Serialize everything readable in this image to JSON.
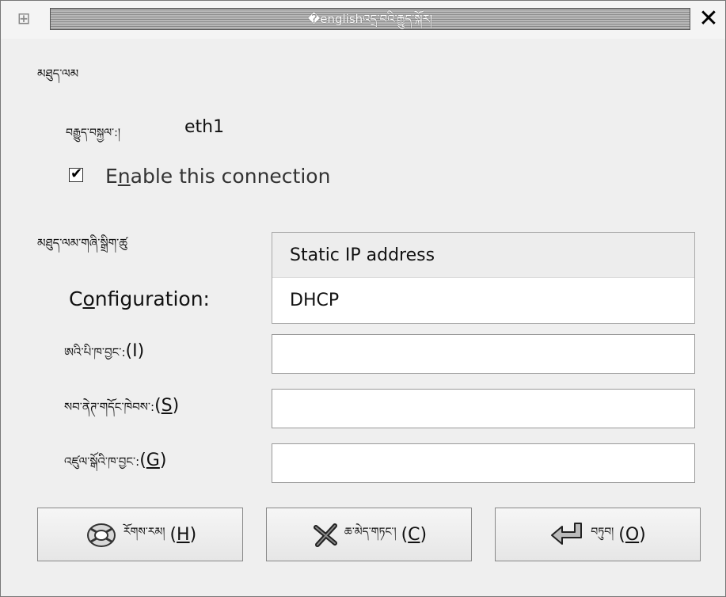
{
  "window": {
    "title": "�englishའདྲ་བའི་རྒྱུད་སྐོར།",
    "close_glyph": "✕"
  },
  "section_device": {
    "label": "མཐུད་ལམ",
    "interface_label": "བརྒྱུད་བསྐྱལ་:།",
    "interface_value": "eth1"
  },
  "enable_checkbox": {
    "checked": true,
    "label_pre": "E",
    "label_mnemonic": "n",
    "label_post": "able this connection"
  },
  "section_settings": {
    "label": "མཐུད་ལམ་གཞི་སྒྲིག་ཚུ"
  },
  "configuration": {
    "label_pre": "C",
    "label_mnemonic": "o",
    "label_post": "nfiguration:",
    "options": [
      "Static IP address",
      "DHCP"
    ],
    "selected": "DHCP"
  },
  "fields": [
    {
      "label_tibetan": "ཨའི་པི་ཁ་བྱང་:",
      "label_key": "(I)",
      "value": ""
    },
    {
      "label_tibetan": "སབ་ནེཊ་གདོང་ཁེབས་:",
      "label_key_pre": "(",
      "label_mnemonic": "S",
      "label_key_post": ")",
      "value": ""
    },
    {
      "label_tibetan": "འཛུལ་སྒོའི་ཁ་བྱང་:",
      "label_key_pre": "(",
      "label_mnemonic": "G",
      "label_key_post": ")",
      "value": ""
    }
  ],
  "buttons": {
    "help": {
      "text": "རོགས་རམ།",
      "key_pre": "(",
      "mnemonic": "H",
      "key_post": ")"
    },
    "cancel": {
      "text": "ཆ་མེད་གཏང་།",
      "key_pre": "(",
      "mnemonic": "C",
      "key_post": ")"
    },
    "ok": {
      "text": "བཏུབ།",
      "key_pre": "(",
      "mnemonic": "O",
      "key_post": ")"
    }
  }
}
